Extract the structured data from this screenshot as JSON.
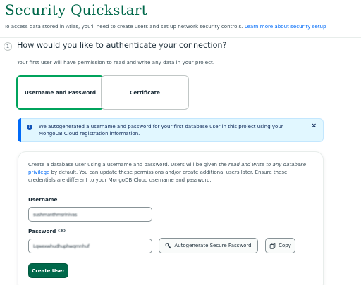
{
  "header": {
    "title": "Security Quickstart",
    "intro": "To access data stored in Atlas, you'll need to create users and set up network security controls.",
    "learn_more_link": "Learn more about security setup"
  },
  "step": {
    "number": "1",
    "question": "How would you like to authenticate your connection?",
    "subtitle": "Your first user will have permission to read and write any data in your project.",
    "options": [
      {
        "label": "Username and Password",
        "selected": true
      },
      {
        "label": "Certificate",
        "selected": false
      }
    ]
  },
  "banner": {
    "icon": "info-icon",
    "text": "We autogenerated a username and password for your first database user in this project using your MongoDB Cloud registration information.",
    "close_glyph": "×"
  },
  "form": {
    "desc_part1": "Create a database user using a username and password. Users will be given the ",
    "desc_emphasis": "read and write to any database",
    "desc_link": "privilege",
    "desc_part2": " by default. You can update these permissions and/or create additional users later. Ensure these credentials are different to your MongoDB Cloud username and password.",
    "username_label": "Username",
    "username_value": "sushmanthmsrinivas",
    "password_label": "Password",
    "password_value": "Lqwexwhudhuphwqmnhuf",
    "autogen_label": "Autogenerate Secure Password",
    "copy_label": "Copy",
    "create_label": "Create User"
  },
  "colors": {
    "brand_green": "#00684a",
    "selected_border": "#00a35c",
    "link_blue": "#016bf8",
    "banner_bg": "#e1f7ff"
  }
}
